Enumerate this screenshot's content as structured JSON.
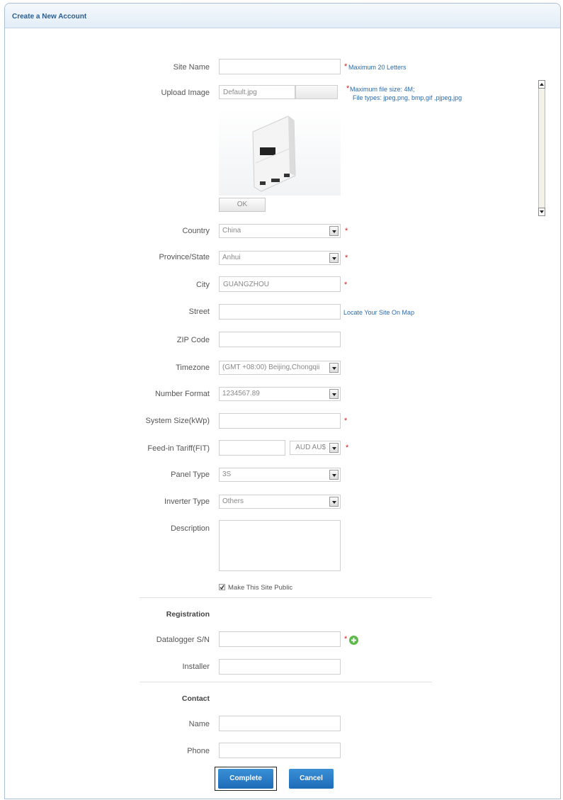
{
  "header": {
    "title": "Create a New Account"
  },
  "form": {
    "site_name": {
      "label": "Site Name",
      "value": "",
      "hint": "Maximum 20 Letters"
    },
    "upload_image": {
      "label": "Upload Image",
      "value": "Default.jpg",
      "hint_line1": "Maximum file size: 4M;",
      "hint_line2": "File types: jpeg,png, bmp,gif ,pjpeg,jpg"
    },
    "ok_button": "OK",
    "country": {
      "label": "Country",
      "value": "China"
    },
    "province": {
      "label": "Province/State",
      "value": "Anhui"
    },
    "city": {
      "label": "City",
      "value": "GUANGZHOU"
    },
    "street": {
      "label": "Street",
      "value": "",
      "link": "Locate Your Site On Map"
    },
    "zip": {
      "label": "ZIP Code",
      "value": ""
    },
    "timezone": {
      "label": "Timezone",
      "value": "(GMT +08:00) Beijing,Chongqii"
    },
    "number_format": {
      "label": "Number Format",
      "value": "1234567.89"
    },
    "system_size": {
      "label": "System Size(kWp)",
      "value": ""
    },
    "feed_in": {
      "label": "Feed-in Tariff(FIT)",
      "value": "",
      "currency": "AUD AU$"
    },
    "panel_type": {
      "label": "Panel Type",
      "value": "3S"
    },
    "inverter_type": {
      "label": "Inverter Type",
      "value": "Others"
    },
    "description": {
      "label": "Description",
      "value": ""
    },
    "make_public": {
      "label": "Make This Site Public",
      "checked": true
    }
  },
  "registration": {
    "title": "Registration",
    "datalogger": {
      "label": "Datalogger S/N",
      "value": ""
    },
    "installer": {
      "label": "Installer",
      "value": ""
    }
  },
  "contact": {
    "title": "Contact",
    "name": {
      "label": "Name",
      "value": ""
    },
    "phone": {
      "label": "Phone",
      "value": ""
    }
  },
  "buttons": {
    "complete": "Complete",
    "cancel": "Cancel"
  },
  "star": "*",
  "colors": {
    "accent": "#2c6bab",
    "required": "#d21f1f",
    "button": "#1d6bb8"
  }
}
